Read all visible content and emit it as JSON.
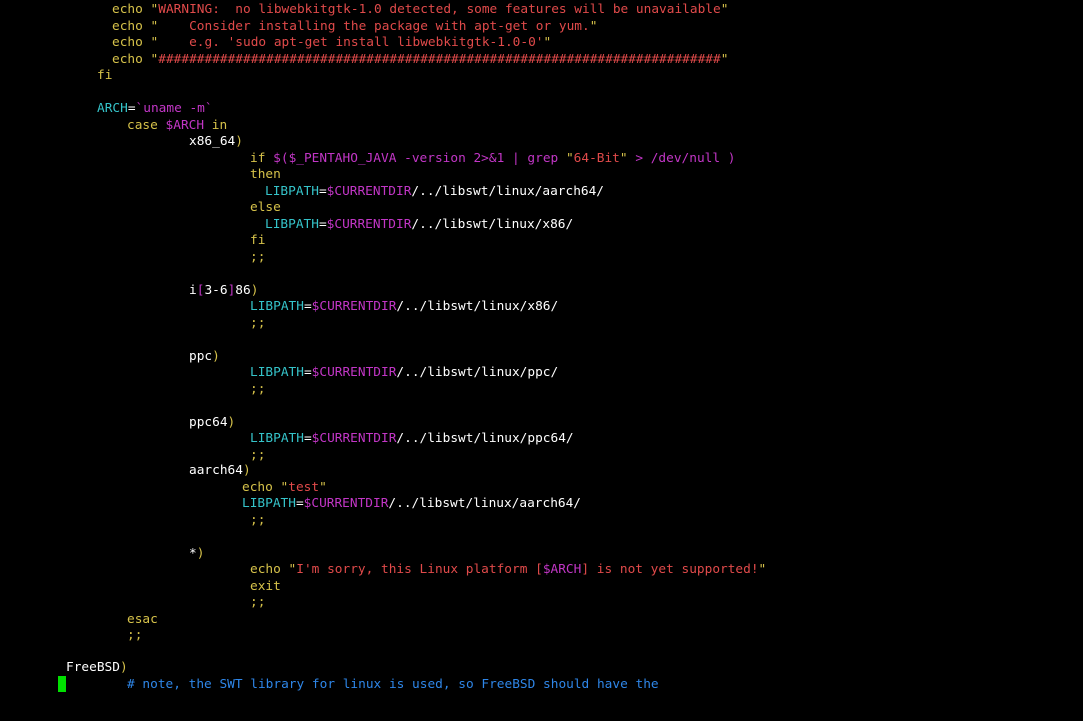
{
  "terminal": {
    "colors": {
      "background": "#000000",
      "keyword": "#d6c24a",
      "string": "#e04a4a",
      "variable": "#c236c6",
      "assignment": "#35c3c9",
      "text": "#ffffff",
      "comment": "#2e86e8",
      "cursor": "#00e000"
    },
    "lines": {
      "l1": {
        "echo": "echo",
        "q1": "\"",
        "str": "WARNING:  no libwebkitgtk-1.0 detected, some features will be unavailable",
        "q2": "\""
      },
      "l2": {
        "echo": "echo",
        "q1": "\"",
        "str": "    Consider installing the package with apt-get or yum.",
        "q2": "\""
      },
      "l3": {
        "echo": "echo",
        "q1": "\"",
        "str": "    e.g. 'sudo apt-get install libwebkitgtk-1.0-0'",
        "q2": "\""
      },
      "l4": {
        "echo": "echo",
        "q1": "\"",
        "str": "#########################################################################",
        "q2": "\""
      },
      "l5": {
        "fi": "fi"
      },
      "l6": {
        "arch": "ARCH",
        "eq": "=",
        "cmd": "`uname -m`"
      },
      "l7": {
        "case": "case",
        "var": "$ARCH",
        "in": "in"
      },
      "l8": {
        "label": "x86_64",
        "paren": ")"
      },
      "l9": {
        "if": "if",
        "sub_open": "$(",
        "var": "$_PENTAHO_JAVA",
        "rest": " -version 2>&1 | grep ",
        "q1": "\"",
        "str": "64-Bit",
        "q2": "\"",
        "tail": " > /dev/null )"
      },
      "l10": {
        "then": "then"
      },
      "l11": {
        "name": "LIBPATH",
        "eq": "=",
        "var": "$CURRENTDIR",
        "path": "/../libswt/linux/aarch64/"
      },
      "l12": {
        "else": "else"
      },
      "l13": {
        "name": "LIBPATH",
        "eq": "=",
        "var": "$CURRENTDIR",
        "path": "/../libswt/linux/x86/"
      },
      "l14": {
        "fi": "fi"
      },
      "l15": {
        "semi": ";;"
      },
      "l16": {
        "label1": "i",
        "br1": "[",
        "range": "3-6",
        "br2": "]",
        "label2": "86",
        "paren": ")"
      },
      "l17": {
        "name": "LIBPATH",
        "eq": "=",
        "var": "$CURRENTDIR",
        "path": "/../libswt/linux/x86/"
      },
      "l18": {
        "semi": ";;"
      },
      "l19": {
        "label": "ppc",
        "paren": ")"
      },
      "l20": {
        "name": "LIBPATH",
        "eq": "=",
        "var": "$CURRENTDIR",
        "path": "/../libswt/linux/ppc/"
      },
      "l21": {
        "semi": ";;"
      },
      "l22": {
        "label": "ppc64",
        "paren": ")"
      },
      "l23": {
        "name": "LIBPATH",
        "eq": "=",
        "var": "$CURRENTDIR",
        "path": "/../libswt/linux/ppc64/"
      },
      "l24": {
        "semi": ";;"
      },
      "l25": {
        "label": "aarch64",
        "paren": ")"
      },
      "l26": {
        "echo": "echo",
        "q1": "\"",
        "str": "test",
        "q2": "\""
      },
      "l27": {
        "name": "LIBPATH",
        "eq": "=",
        "var": "$CURRENTDIR",
        "path": "/../libswt/linux/aarch64/"
      },
      "l28": {
        "semi": ";;"
      },
      "l29": {
        "label": "*",
        "paren": ")"
      },
      "l30": {
        "echo": "echo",
        "q1": "\"",
        "str1": "I'm sorry, this Linux platform [",
        "var": "$ARCH",
        "str2": "] is not yet supported!",
        "q2": "\""
      },
      "l31": {
        "exit": "exit"
      },
      "l32": {
        "semi": ";;"
      },
      "l33": {
        "esac": "esac"
      },
      "l34": {
        "semi": ";;"
      },
      "l35": {
        "label": "FreeBSD",
        "paren": ")"
      },
      "l36": {
        "comment": "# note, the SWT library for linux is used, so FreeBSD should have the"
      }
    }
  }
}
